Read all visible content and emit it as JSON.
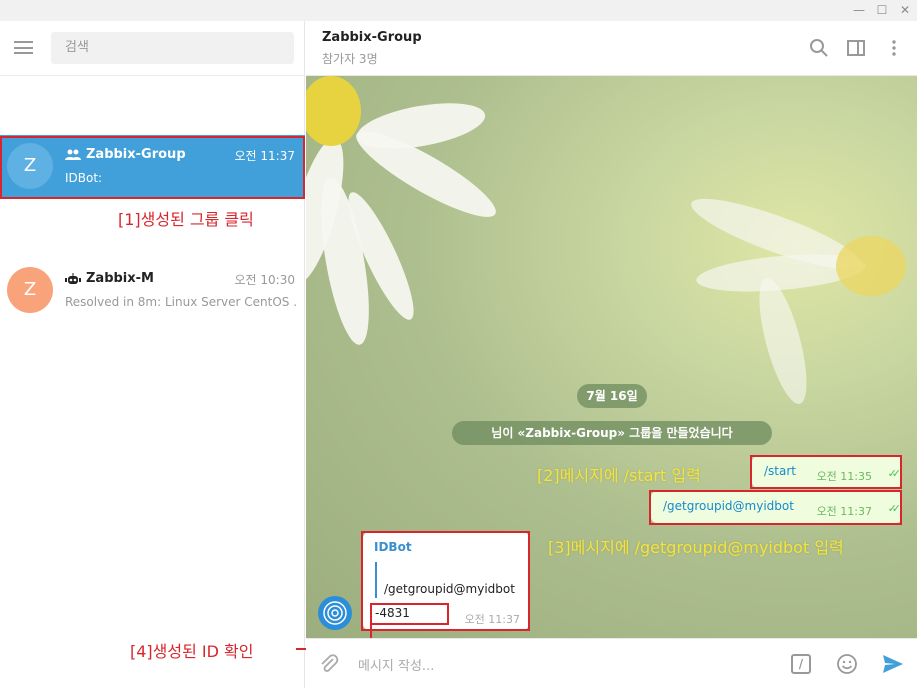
{
  "window": {
    "min": "—",
    "max": "☐",
    "close": "✕"
  },
  "sidebar": {
    "search_placeholder": "검색",
    "chats": [
      {
        "avatar": "Z",
        "name": "Zabbix-Group",
        "time": "오전 11:37",
        "preview": "IDBot:",
        "avatar_color": "#419fd9",
        "active": true
      },
      {
        "avatar": "Z",
        "name": "Zabbix-M",
        "time": "오전 10:30",
        "preview": "Resolved in 8m: Linux Server CentOS ...",
        "avatar_color": "#f9a37a",
        "active": false
      }
    ]
  },
  "header": {
    "title": "Zabbix-Group",
    "subtitle": "참가자 3명"
  },
  "messages": {
    "date_pill": "7월 16일",
    "service_pill": "님이 «Zabbix-Group» 그룹을 만들었습니다",
    "out": [
      {
        "text": "/start",
        "time": "오전 11:35"
      },
      {
        "text": "/getgroupid@myidbot",
        "time": "오전 11:37"
      }
    ],
    "in": {
      "sender": "IDBot",
      "reply_quote": "/getgroupid@myidbot",
      "text": "-4831",
      "time": "오전 11:37"
    }
  },
  "annotations": {
    "a1": "[1]생성된 그룹 클릭",
    "a2": "[2]메시지에 /start 입력",
    "a3": "[3]메시지에 /getgroupid@myidbot 입력",
    "a4": "[4]생성된 ID 확인"
  },
  "composer": {
    "placeholder": "메시지 작성...",
    "slash": "/"
  },
  "colors": {
    "accent": "#419fd9",
    "annotation_red": "#d7262d",
    "annotation_yellow": "#f5e33a"
  }
}
